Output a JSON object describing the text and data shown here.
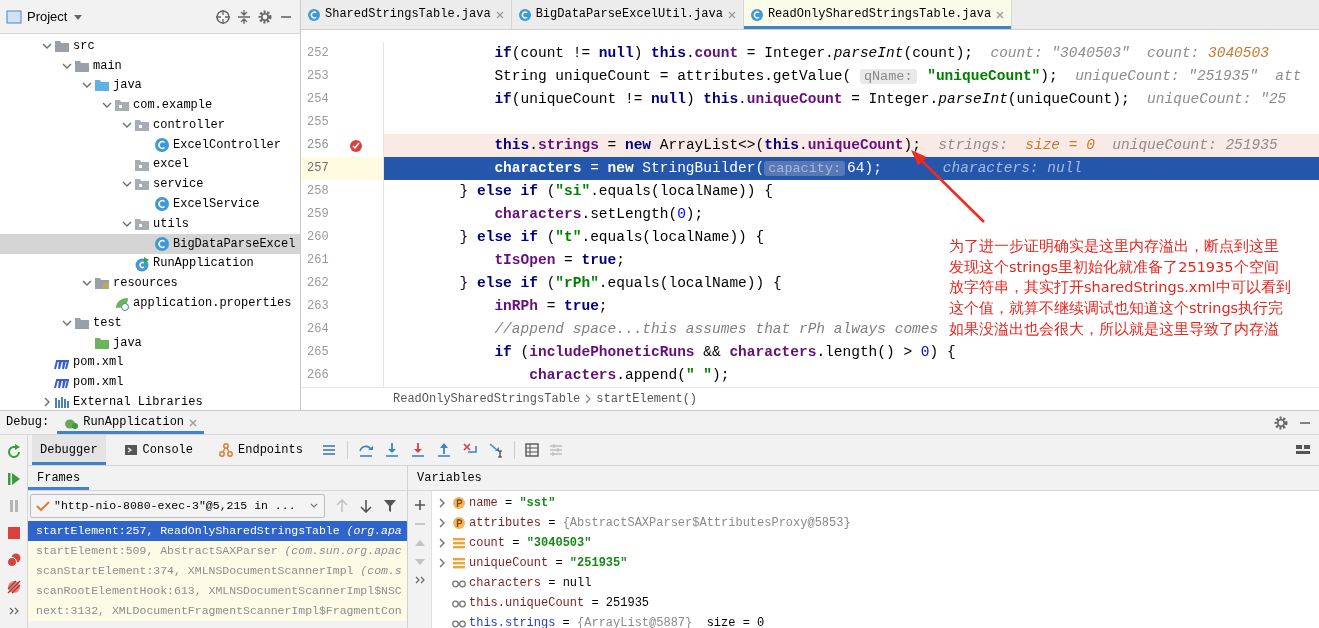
{
  "project_panel": {
    "title": "Project",
    "tree": [
      {
        "label": "src",
        "kind": "folder",
        "expanded": true,
        "selected": false,
        "children": [
          {
            "label": "main",
            "kind": "folder",
            "expanded": true,
            "selected": false,
            "children": [
              {
                "label": "java",
                "kind": "source-folder",
                "expanded": true,
                "selected": false,
                "children": [
                  {
                    "label": "com.example",
                    "kind": "package",
                    "expanded": true,
                    "selected": false,
                    "children": [
                      {
                        "label": "controller",
                        "kind": "package",
                        "expanded": true,
                        "selected": false,
                        "children": [
                          {
                            "label": "ExcelController",
                            "kind": "class",
                            "selected": false
                          }
                        ]
                      },
                      {
                        "label": "excel",
                        "kind": "package",
                        "selected": false
                      },
                      {
                        "label": "service",
                        "kind": "package",
                        "expanded": true,
                        "selected": false,
                        "children": [
                          {
                            "label": "ExcelService",
                            "kind": "class",
                            "selected": false
                          }
                        ]
                      },
                      {
                        "label": "utils",
                        "kind": "package",
                        "expanded": true,
                        "selected": false,
                        "children": [
                          {
                            "label": "BigDataParseExcel",
                            "kind": "class",
                            "selected": true
                          }
                        ]
                      },
                      {
                        "label": "RunApplication",
                        "kind": "main-class",
                        "selected": false
                      }
                    ]
                  }
                ]
              },
              {
                "label": "resources",
                "kind": "resources",
                "expanded": true,
                "selected": false,
                "children": [
                  {
                    "label": "application.properties",
                    "kind": "properties",
                    "selected": false
                  }
                ]
              }
            ]
          },
          {
            "label": "test",
            "kind": "folder",
            "expanded": true,
            "selected": false,
            "children": [
              {
                "label": "java",
                "kind": "test-folder",
                "selected": false
              }
            ]
          }
        ]
      },
      {
        "label": "pom.xml",
        "kind": "maven",
        "selected": false
      },
      {
        "label": "pom.xml",
        "kind": "maven",
        "selected": false
      },
      {
        "label": "External Libraries",
        "kind": "libraries",
        "expanded": false,
        "selected": false
      }
    ]
  },
  "editor": {
    "tabs": [
      {
        "label": "SharedStringsTable.java",
        "selected": false
      },
      {
        "label": "BigDataParseExcelUtil.java",
        "selected": false
      },
      {
        "label": "ReadOnlySharedStringsTable.java",
        "selected": true
      }
    ],
    "lines": [
      {
        "number": "252",
        "breakpoint": false,
        "current": false,
        "tokens": [
          {
            "kind": "kw",
            "text": "            if"
          },
          {
            "kind": "plain",
            "text": "(count != "
          },
          {
            "kind": "kw",
            "text": "null"
          },
          {
            "kind": "plain",
            "text": ") "
          },
          {
            "kind": "kw",
            "text": "this"
          },
          {
            "kind": "plain",
            "text": "."
          },
          {
            "kind": "field",
            "text": "count"
          },
          {
            "kind": "plain",
            "text": " = Integer."
          },
          {
            "kind": "static",
            "text": "parseInt"
          },
          {
            "kind": "plain",
            "text": "(count);"
          },
          {
            "kind": "inline",
            "text": "  count: \"3040503\"  count: "
          },
          {
            "kind": "inline-val",
            "text": "3040503"
          }
        ]
      },
      {
        "number": "253",
        "breakpoint": false,
        "current": false,
        "tokens": [
          {
            "kind": "plain",
            "text": "            String uniqueCount = attributes.getValue( "
          },
          {
            "kind": "hint",
            "text": "qName:"
          },
          {
            "kind": "str",
            "text": " \"uniqueCount\""
          },
          {
            "kind": "plain",
            "text": ");"
          },
          {
            "kind": "inline",
            "text": "  uniqueCount: \"251935\"  att"
          }
        ]
      },
      {
        "number": "254",
        "breakpoint": false,
        "current": false,
        "tokens": [
          {
            "kind": "kw",
            "text": "            if"
          },
          {
            "kind": "plain",
            "text": "(uniqueCount != "
          },
          {
            "kind": "kw",
            "text": "null"
          },
          {
            "kind": "plain",
            "text": ") "
          },
          {
            "kind": "kw",
            "text": "this"
          },
          {
            "kind": "plain",
            "text": "."
          },
          {
            "kind": "field",
            "text": "uniqueCount"
          },
          {
            "kind": "plain",
            "text": " = Integer."
          },
          {
            "kind": "static",
            "text": "parseInt"
          },
          {
            "kind": "plain",
            "text": "(uniqueCount);"
          },
          {
            "kind": "inline",
            "text": "  uniqueCount: \"25"
          }
        ]
      },
      {
        "number": "255",
        "breakpoint": false,
        "current": false
      },
      {
        "number": "256",
        "breakpoint": true,
        "current": false,
        "tokens": [
          {
            "kind": "kw",
            "text": "            this"
          },
          {
            "kind": "plain",
            "text": "."
          },
          {
            "kind": "field",
            "text": "strings"
          },
          {
            "kind": "plain",
            "text": " = "
          },
          {
            "kind": "kw",
            "text": "new"
          },
          {
            "kind": "plain",
            "text": " ArrayList<>("
          },
          {
            "kind": "kw",
            "text": "this"
          },
          {
            "kind": "plain",
            "text": "."
          },
          {
            "kind": "field",
            "text": "uniqueCount"
          },
          {
            "kind": "plain",
            "text": ");"
          },
          {
            "kind": "inline",
            "text": "  strings:  "
          },
          {
            "kind": "inline-val",
            "text": "size = 0"
          },
          {
            "kind": "inline",
            "text": "  uniqueCount: 251935"
          }
        ]
      },
      {
        "number": "257",
        "breakpoint": false,
        "current": true,
        "tokens": [
          {
            "kind": "field",
            "text": "            characters"
          },
          {
            "kind": "plain",
            "text": " = "
          },
          {
            "kind": "kw",
            "text": "new"
          },
          {
            "kind": "plain",
            "text": " StringBuilder("
          },
          {
            "kind": "hint",
            "text": "capacity:"
          },
          {
            "kind": "num",
            "text": "64"
          },
          {
            "kind": "plain",
            "text": ");"
          },
          {
            "kind": "inline",
            "text": "       characters: null"
          }
        ]
      },
      {
        "number": "258",
        "breakpoint": false,
        "current": false,
        "tokens": [
          {
            "kind": "plain",
            "text": "        } "
          },
          {
            "kind": "kw",
            "text": "else if"
          },
          {
            "kind": "plain",
            "text": " ("
          },
          {
            "kind": "str",
            "text": "\"si\""
          },
          {
            "kind": "plain",
            "text": ".equals(localName)) {"
          }
        ]
      },
      {
        "number": "259",
        "breakpoint": false,
        "current": false,
        "tokens": [
          {
            "kind": "field",
            "text": "            characters"
          },
          {
            "kind": "plain",
            "text": ".setLength("
          },
          {
            "kind": "num",
            "text": "0"
          },
          {
            "kind": "plain",
            "text": ");"
          }
        ]
      },
      {
        "number": "260",
        "breakpoint": false,
        "current": false,
        "tokens": [
          {
            "kind": "plain",
            "text": "        } "
          },
          {
            "kind": "kw",
            "text": "else if"
          },
          {
            "kind": "plain",
            "text": " ("
          },
          {
            "kind": "str",
            "text": "\"t\""
          },
          {
            "kind": "plain",
            "text": ".equals(localName)) {"
          }
        ]
      },
      {
        "number": "261",
        "breakpoint": false,
        "current": false,
        "tokens": [
          {
            "kind": "field",
            "text": "            tIsOpen"
          },
          {
            "kind": "plain",
            "text": " = "
          },
          {
            "kind": "kw",
            "text": "true"
          },
          {
            "kind": "plain",
            "text": ";"
          }
        ]
      },
      {
        "number": "262",
        "breakpoint": false,
        "current": false,
        "tokens": [
          {
            "kind": "plain",
            "text": "        } "
          },
          {
            "kind": "kw",
            "text": "else if"
          },
          {
            "kind": "plain",
            "text": " ("
          },
          {
            "kind": "str",
            "text": "\"rPh\""
          },
          {
            "kind": "plain",
            "text": ".equals(localName)) {"
          }
        ]
      },
      {
        "number": "263",
        "breakpoint": false,
        "current": false,
        "tokens": [
          {
            "kind": "field",
            "text": "            inRPh"
          },
          {
            "kind": "plain",
            "text": " = "
          },
          {
            "kind": "kw",
            "text": "true"
          },
          {
            "kind": "plain",
            "text": ";"
          }
        ]
      },
      {
        "number": "264",
        "breakpoint": false,
        "current": false,
        "tokens": [
          {
            "kind": "comment",
            "text": "            //append space...this assumes that rPh always comes"
          }
        ]
      },
      {
        "number": "265",
        "breakpoint": false,
        "current": false,
        "tokens": [
          {
            "kind": "kw",
            "text": "            if"
          },
          {
            "kind": "plain",
            "text": " ("
          },
          {
            "kind": "field",
            "text": "includePhoneticRuns"
          },
          {
            "kind": "plain",
            "text": " && "
          },
          {
            "kind": "field",
            "text": "characters"
          },
          {
            "kind": "plain",
            "text": ".length() > "
          },
          {
            "kind": "num",
            "text": "0"
          },
          {
            "kind": "plain",
            "text": ") {"
          }
        ]
      },
      {
        "number": "266",
        "breakpoint": false,
        "current": false,
        "tokens": [
          {
            "kind": "field",
            "text": "                characters"
          },
          {
            "kind": "plain",
            "text": ".append("
          },
          {
            "kind": "str",
            "text": "\" \""
          },
          {
            "kind": "plain",
            "text": ");"
          }
        ]
      }
    ],
    "breadcrumb": [
      "ReadOnlySharedStringsTable",
      "startElement()"
    ]
  },
  "annotation": {
    "lines": [
      "为了进一步证明确实是这里内存溢出，断点到这里",
      "发现这个strings里初始化就准备了251935个空间",
      "放字符串，其实打开sharedStrings.xml中可以看到",
      "这个值，就算不继续调试也知道这个strings执行完",
      "如果没溢出也会很大，所以就是这里导致了内存溢"
    ]
  },
  "debug": {
    "label": "Debug:",
    "session": "RunApplication",
    "tabs": [
      {
        "label": "Debugger",
        "kind": "debugger",
        "selected": true
      },
      {
        "label": "Console",
        "kind": "console",
        "selected": false
      },
      {
        "label": "Endpoints",
        "kind": "endpoints",
        "selected": false
      }
    ],
    "frames_title": "Frames",
    "variables_title": "Variables",
    "thread": "\"http-nio-8080-exec-3\"@5,215 in ...",
    "frames": [
      {
        "method": "startElement:257, ReadOnlySharedStringsTable ",
        "package": "(org.apa",
        "selected": true
      },
      {
        "method": "startElement:509, AbstractSAXParser ",
        "package": "(com.sun.org.apac",
        "selected": false
      },
      {
        "method": "scanStartElement:374, XMLNSDocumentScannerImpl ",
        "package": "(com.s",
        "selected": false
      },
      {
        "method": "scanRootElementHook:613, XMLNSDocumentScannerImpl$NSC",
        "selected": false
      },
      {
        "method": "next:3132, XMLDocumentFragmentScannerImpl$FragmentCon",
        "selected": false
      }
    ],
    "variables": [
      {
        "kind": "field",
        "name": "name",
        "operator": "=",
        "value": {
          "kind": "string",
          "text": "\"sst\""
        },
        "expandable": true,
        "changed": false
      },
      {
        "kind": "field",
        "name": "attributes",
        "operator": "=",
        "value": {
          "kind": "object",
          "text": "{AbstractSAXParser$AttributesProxy@5853}"
        },
        "expandable": true,
        "changed": false
      },
      {
        "kind": "local",
        "name": "count",
        "operator": "=",
        "value": {
          "kind": "string",
          "text": "\"3040503\""
        },
        "expandable": true,
        "changed": false
      },
      {
        "kind": "local",
        "name": "uniqueCount",
        "operator": "=",
        "value": {
          "kind": "string",
          "text": "\"251935\""
        },
        "expandable": true,
        "changed": false
      },
      {
        "kind": "watch",
        "name": "characters",
        "operator": "=",
        "value": {
          "kind": "plain",
          "text": "null"
        },
        "expandable": false,
        "changed": false
      },
      {
        "kind": "watch",
        "name": "this.uniqueCount",
        "operator": "=",
        "value": {
          "kind": "plain",
          "text": "251935"
        },
        "expandable": false,
        "changed": false
      },
      {
        "kind": "watch",
        "name": "this.strings",
        "operator": "=",
        "value": {
          "kind": "object",
          "text": "{ArrayList@5887}"
        },
        "extra": "size = 0",
        "expandable": false,
        "changed": true
      }
    ]
  }
}
